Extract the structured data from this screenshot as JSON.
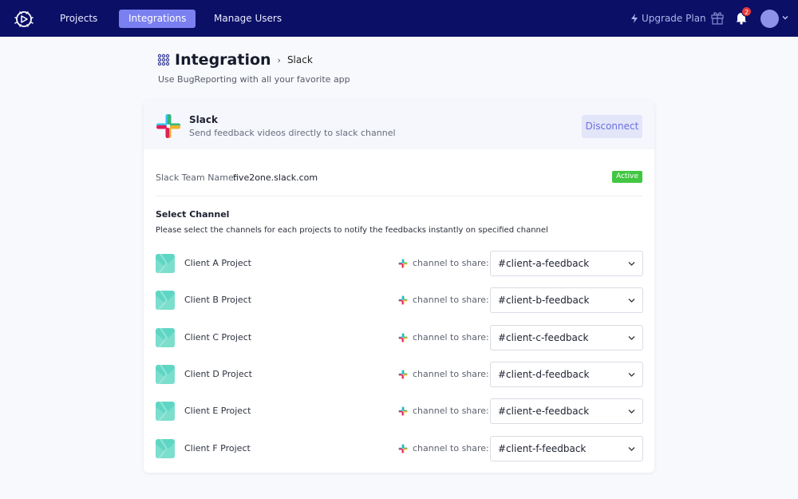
{
  "nav": {
    "items": [
      {
        "label": "Projects",
        "active": false
      },
      {
        "label": "Integrations",
        "active": true
      },
      {
        "label": "Manage Users",
        "active": false
      }
    ],
    "upgrade_label": "Upgrade Plan",
    "notification_count": "2",
    "icons": [
      "bug-logo-icon",
      "lightning-icon",
      "gift-icon",
      "bell-icon",
      "chevron-down-icon"
    ]
  },
  "header": {
    "title": "Integration",
    "breadcrumb": "Slack",
    "subtitle": "Use BugReporting with all your favorite app"
  },
  "integration": {
    "name": "Slack",
    "description": "Send feedback videos directly to slack channel",
    "disconnect_label": "Disconnect",
    "team_label": "Slack Team Name:",
    "team_value": "five2one.slack.com",
    "status": "Active"
  },
  "channels": {
    "title": "Select Channel",
    "description": "Please select the channels for each projects to notify the feedbacks instantly on specified channel",
    "share_label": "channel to share:",
    "rows": [
      {
        "project": "Client A Project",
        "channel": "#client-a-feedback"
      },
      {
        "project": "Client B Project",
        "channel": "#client-b-feedback"
      },
      {
        "project": "Client C Project",
        "channel": "#client-c-feedback"
      },
      {
        "project": "Client D Project",
        "channel": "#client-d-feedback"
      },
      {
        "project": "Client E Project",
        "channel": "#client-e-feedback"
      },
      {
        "project": "Client F Project",
        "channel": "#client-f-feedback"
      }
    ]
  },
  "colors": {
    "nav_bg": "#0b0f66",
    "accent": "#7a80f0",
    "active_badge": "#42c742",
    "notification": "#e53b3b",
    "project_icon": "#5fd6c4"
  }
}
